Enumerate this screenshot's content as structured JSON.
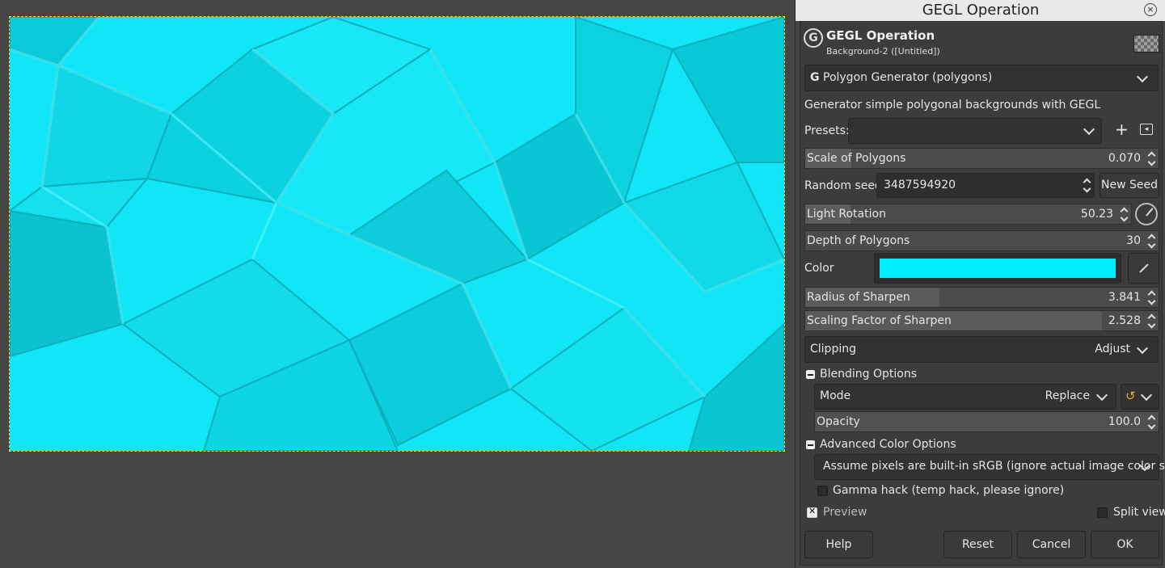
{
  "window": {
    "title": "GEGL Operation",
    "close_glyph": "×"
  },
  "header": {
    "title": "GEGL Operation",
    "subtitle": "Background-2 ([Untitled])",
    "logo_glyph": "G"
  },
  "operation": {
    "selected": "Polygon Generator (polygons)",
    "description": "Generator simple polygonal backgrounds with GEGL"
  },
  "presets": {
    "label": "Presets:",
    "value": "",
    "add_glyph": "+",
    "menu_glyph": "◂"
  },
  "params": {
    "scale": {
      "label": "Scale of Polygons",
      "value": "0.070",
      "fill_fraction": 0.13
    },
    "seed": {
      "label": "Random seed",
      "value": "3487594920",
      "new_seed_label": "New Seed"
    },
    "light_rotation": {
      "label": "Light Rotation",
      "value": "50.23",
      "fill_fraction": 0.14
    },
    "depth": {
      "label": "Depth of Polygons",
      "value": "30"
    },
    "color": {
      "label": "Color",
      "value": "#00eeff"
    },
    "radius_sharpen": {
      "label": "Radius of Sharpen",
      "value": "3.841",
      "fill_fraction": 0.38
    },
    "scaling_sharpen": {
      "label": "Scaling Factor of Sharpen",
      "value": "2.528",
      "fill_fraction": 0.84
    },
    "clipping": {
      "label": "Clipping",
      "value": "Adjust"
    }
  },
  "blending": {
    "title": "Blending Options",
    "mode_label": "Mode",
    "mode_value": "Replace",
    "opacity_label": "Opacity",
    "opacity_value": "100.0"
  },
  "advanced": {
    "title": "Advanced Color Options",
    "assumption": "Assume pixels are built-in sRGB (ignore actual image color space)",
    "gamma_label": "Gamma hack (temp hack, please ignore)"
  },
  "preview": {
    "label": "Preview",
    "checked": true,
    "split_label": "Split view"
  },
  "buttons": {
    "help": "Help",
    "reset": "Reset",
    "cancel": "Cancel",
    "ok": "OK"
  },
  "colors": {
    "canvas_fill": "#0fe3f2",
    "panel_bg": "#3c3c3c",
    "selection_outline": "#e8e030"
  }
}
